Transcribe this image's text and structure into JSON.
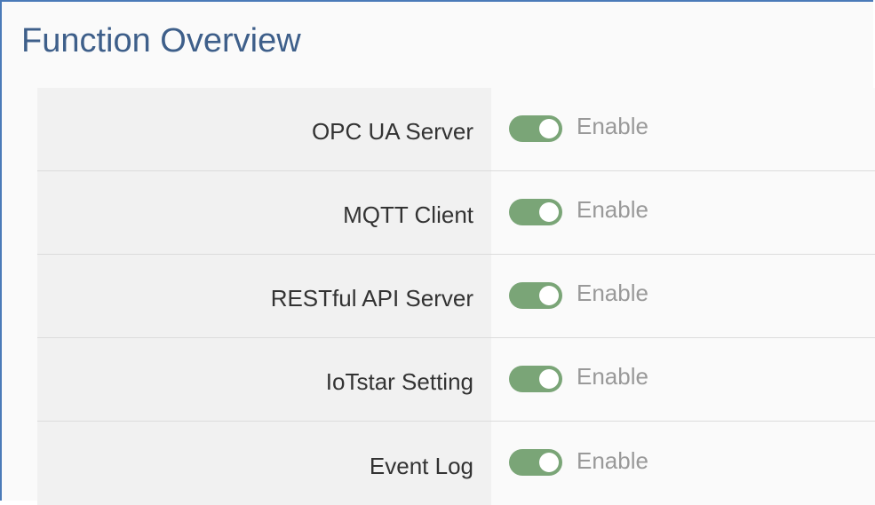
{
  "page": {
    "title": "Function Overview"
  },
  "colors": {
    "toggle_on": "#7aa577"
  },
  "functions": [
    {
      "label": "OPC UA Server",
      "state": "Enable",
      "enabled": true
    },
    {
      "label": "MQTT Client",
      "state": "Enable",
      "enabled": true
    },
    {
      "label": "RESTful API Server",
      "state": "Enable",
      "enabled": true
    },
    {
      "label": "IoTstar Setting",
      "state": "Enable",
      "enabled": true
    },
    {
      "label": "Event Log",
      "state": "Enable",
      "enabled": true
    }
  ]
}
